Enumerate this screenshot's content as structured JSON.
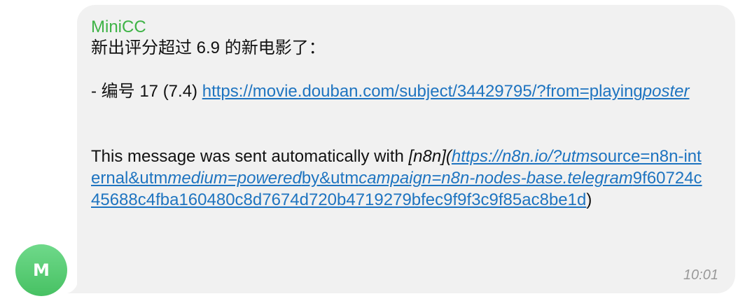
{
  "avatar": {
    "initial": "M"
  },
  "message": {
    "sender": "MiniCC",
    "headline": "新出评分超过 6.9 的新电影了：",
    "item_prefix": "- 编号 17 (7.4) ",
    "item_link": "https://movie.douban.com/subject/34429795/?from=playing",
    "item_link_italic": "poster",
    "footer_prefix": "This message was sent automatically with ",
    "footer_n8n": "[n8n]",
    "footer_paren_open": "(",
    "footer_link_parts": [
      {
        "text": "https://n8n.io/?",
        "italic": true
      },
      {
        "text": "utm",
        "italic": true
      },
      {
        "text": "source=n8n-internal&utm",
        "italic": false
      },
      {
        "text": "medium=powered",
        "italic": true
      },
      {
        "text": "by&utm",
        "italic": false
      },
      {
        "text": "campaign=n8n-nodes-base.telegram",
        "italic": true
      },
      {
        "text": "9f60724c45688c4fba160480c8d7674d720b4719279bfec9f9f3c9f85ac8be1d",
        "italic": false
      }
    ],
    "footer_paren_close": ")",
    "time": "10:01"
  },
  "colors": {
    "sender": "#3eb346",
    "link": "#1e74c0",
    "bubble": "#f1f1f1",
    "avatar": "#52c56c"
  }
}
